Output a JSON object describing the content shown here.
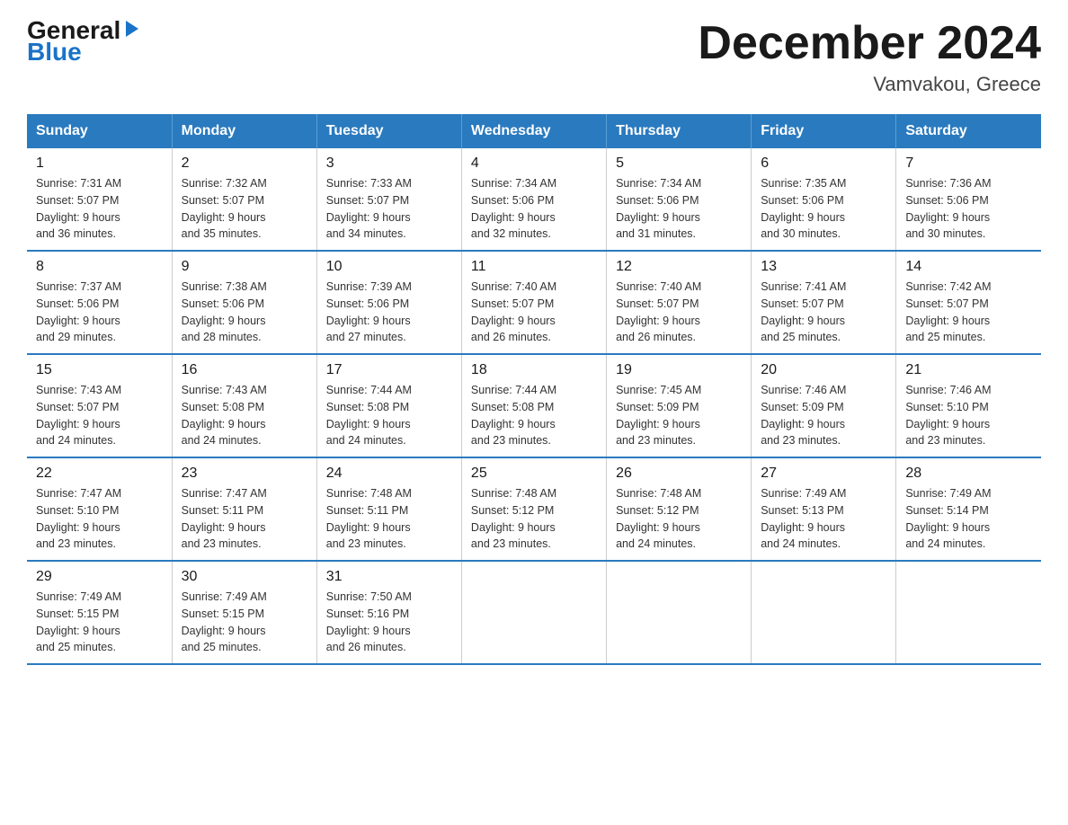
{
  "logo": {
    "general": "General",
    "blue": "Blue",
    "arrow": "▶"
  },
  "title": "December 2024",
  "location": "Vamvakou, Greece",
  "days_of_week": [
    "Sunday",
    "Monday",
    "Tuesday",
    "Wednesday",
    "Thursday",
    "Friday",
    "Saturday"
  ],
  "weeks": [
    [
      {
        "day": "1",
        "sunrise": "7:31 AM",
        "sunset": "5:07 PM",
        "daylight": "9 hours and 36 minutes."
      },
      {
        "day": "2",
        "sunrise": "7:32 AM",
        "sunset": "5:07 PM",
        "daylight": "9 hours and 35 minutes."
      },
      {
        "day": "3",
        "sunrise": "7:33 AM",
        "sunset": "5:07 PM",
        "daylight": "9 hours and 34 minutes."
      },
      {
        "day": "4",
        "sunrise": "7:34 AM",
        "sunset": "5:06 PM",
        "daylight": "9 hours and 32 minutes."
      },
      {
        "day": "5",
        "sunrise": "7:34 AM",
        "sunset": "5:06 PM",
        "daylight": "9 hours and 31 minutes."
      },
      {
        "day": "6",
        "sunrise": "7:35 AM",
        "sunset": "5:06 PM",
        "daylight": "9 hours and 30 minutes."
      },
      {
        "day": "7",
        "sunrise": "7:36 AM",
        "sunset": "5:06 PM",
        "daylight": "9 hours and 30 minutes."
      }
    ],
    [
      {
        "day": "8",
        "sunrise": "7:37 AM",
        "sunset": "5:06 PM",
        "daylight": "9 hours and 29 minutes."
      },
      {
        "day": "9",
        "sunrise": "7:38 AM",
        "sunset": "5:06 PM",
        "daylight": "9 hours and 28 minutes."
      },
      {
        "day": "10",
        "sunrise": "7:39 AM",
        "sunset": "5:06 PM",
        "daylight": "9 hours and 27 minutes."
      },
      {
        "day": "11",
        "sunrise": "7:40 AM",
        "sunset": "5:07 PM",
        "daylight": "9 hours and 26 minutes."
      },
      {
        "day": "12",
        "sunrise": "7:40 AM",
        "sunset": "5:07 PM",
        "daylight": "9 hours and 26 minutes."
      },
      {
        "day": "13",
        "sunrise": "7:41 AM",
        "sunset": "5:07 PM",
        "daylight": "9 hours and 25 minutes."
      },
      {
        "day": "14",
        "sunrise": "7:42 AM",
        "sunset": "5:07 PM",
        "daylight": "9 hours and 25 minutes."
      }
    ],
    [
      {
        "day": "15",
        "sunrise": "7:43 AM",
        "sunset": "5:07 PM",
        "daylight": "9 hours and 24 minutes."
      },
      {
        "day": "16",
        "sunrise": "7:43 AM",
        "sunset": "5:08 PM",
        "daylight": "9 hours and 24 minutes."
      },
      {
        "day": "17",
        "sunrise": "7:44 AM",
        "sunset": "5:08 PM",
        "daylight": "9 hours and 24 minutes."
      },
      {
        "day": "18",
        "sunrise": "7:44 AM",
        "sunset": "5:08 PM",
        "daylight": "9 hours and 23 minutes."
      },
      {
        "day": "19",
        "sunrise": "7:45 AM",
        "sunset": "5:09 PM",
        "daylight": "9 hours and 23 minutes."
      },
      {
        "day": "20",
        "sunrise": "7:46 AM",
        "sunset": "5:09 PM",
        "daylight": "9 hours and 23 minutes."
      },
      {
        "day": "21",
        "sunrise": "7:46 AM",
        "sunset": "5:10 PM",
        "daylight": "9 hours and 23 minutes."
      }
    ],
    [
      {
        "day": "22",
        "sunrise": "7:47 AM",
        "sunset": "5:10 PM",
        "daylight": "9 hours and 23 minutes."
      },
      {
        "day": "23",
        "sunrise": "7:47 AM",
        "sunset": "5:11 PM",
        "daylight": "9 hours and 23 minutes."
      },
      {
        "day": "24",
        "sunrise": "7:48 AM",
        "sunset": "5:11 PM",
        "daylight": "9 hours and 23 minutes."
      },
      {
        "day": "25",
        "sunrise": "7:48 AM",
        "sunset": "5:12 PM",
        "daylight": "9 hours and 23 minutes."
      },
      {
        "day": "26",
        "sunrise": "7:48 AM",
        "sunset": "5:12 PM",
        "daylight": "9 hours and 24 minutes."
      },
      {
        "day": "27",
        "sunrise": "7:49 AM",
        "sunset": "5:13 PM",
        "daylight": "9 hours and 24 minutes."
      },
      {
        "day": "28",
        "sunrise": "7:49 AM",
        "sunset": "5:14 PM",
        "daylight": "9 hours and 24 minutes."
      }
    ],
    [
      {
        "day": "29",
        "sunrise": "7:49 AM",
        "sunset": "5:15 PM",
        "daylight": "9 hours and 25 minutes."
      },
      {
        "day": "30",
        "sunrise": "7:49 AM",
        "sunset": "5:15 PM",
        "daylight": "9 hours and 25 minutes."
      },
      {
        "day": "31",
        "sunrise": "7:50 AM",
        "sunset": "5:16 PM",
        "daylight": "9 hours and 26 minutes."
      },
      null,
      null,
      null,
      null
    ]
  ],
  "labels": {
    "sunrise": "Sunrise:",
    "sunset": "Sunset:",
    "daylight": "Daylight:"
  }
}
